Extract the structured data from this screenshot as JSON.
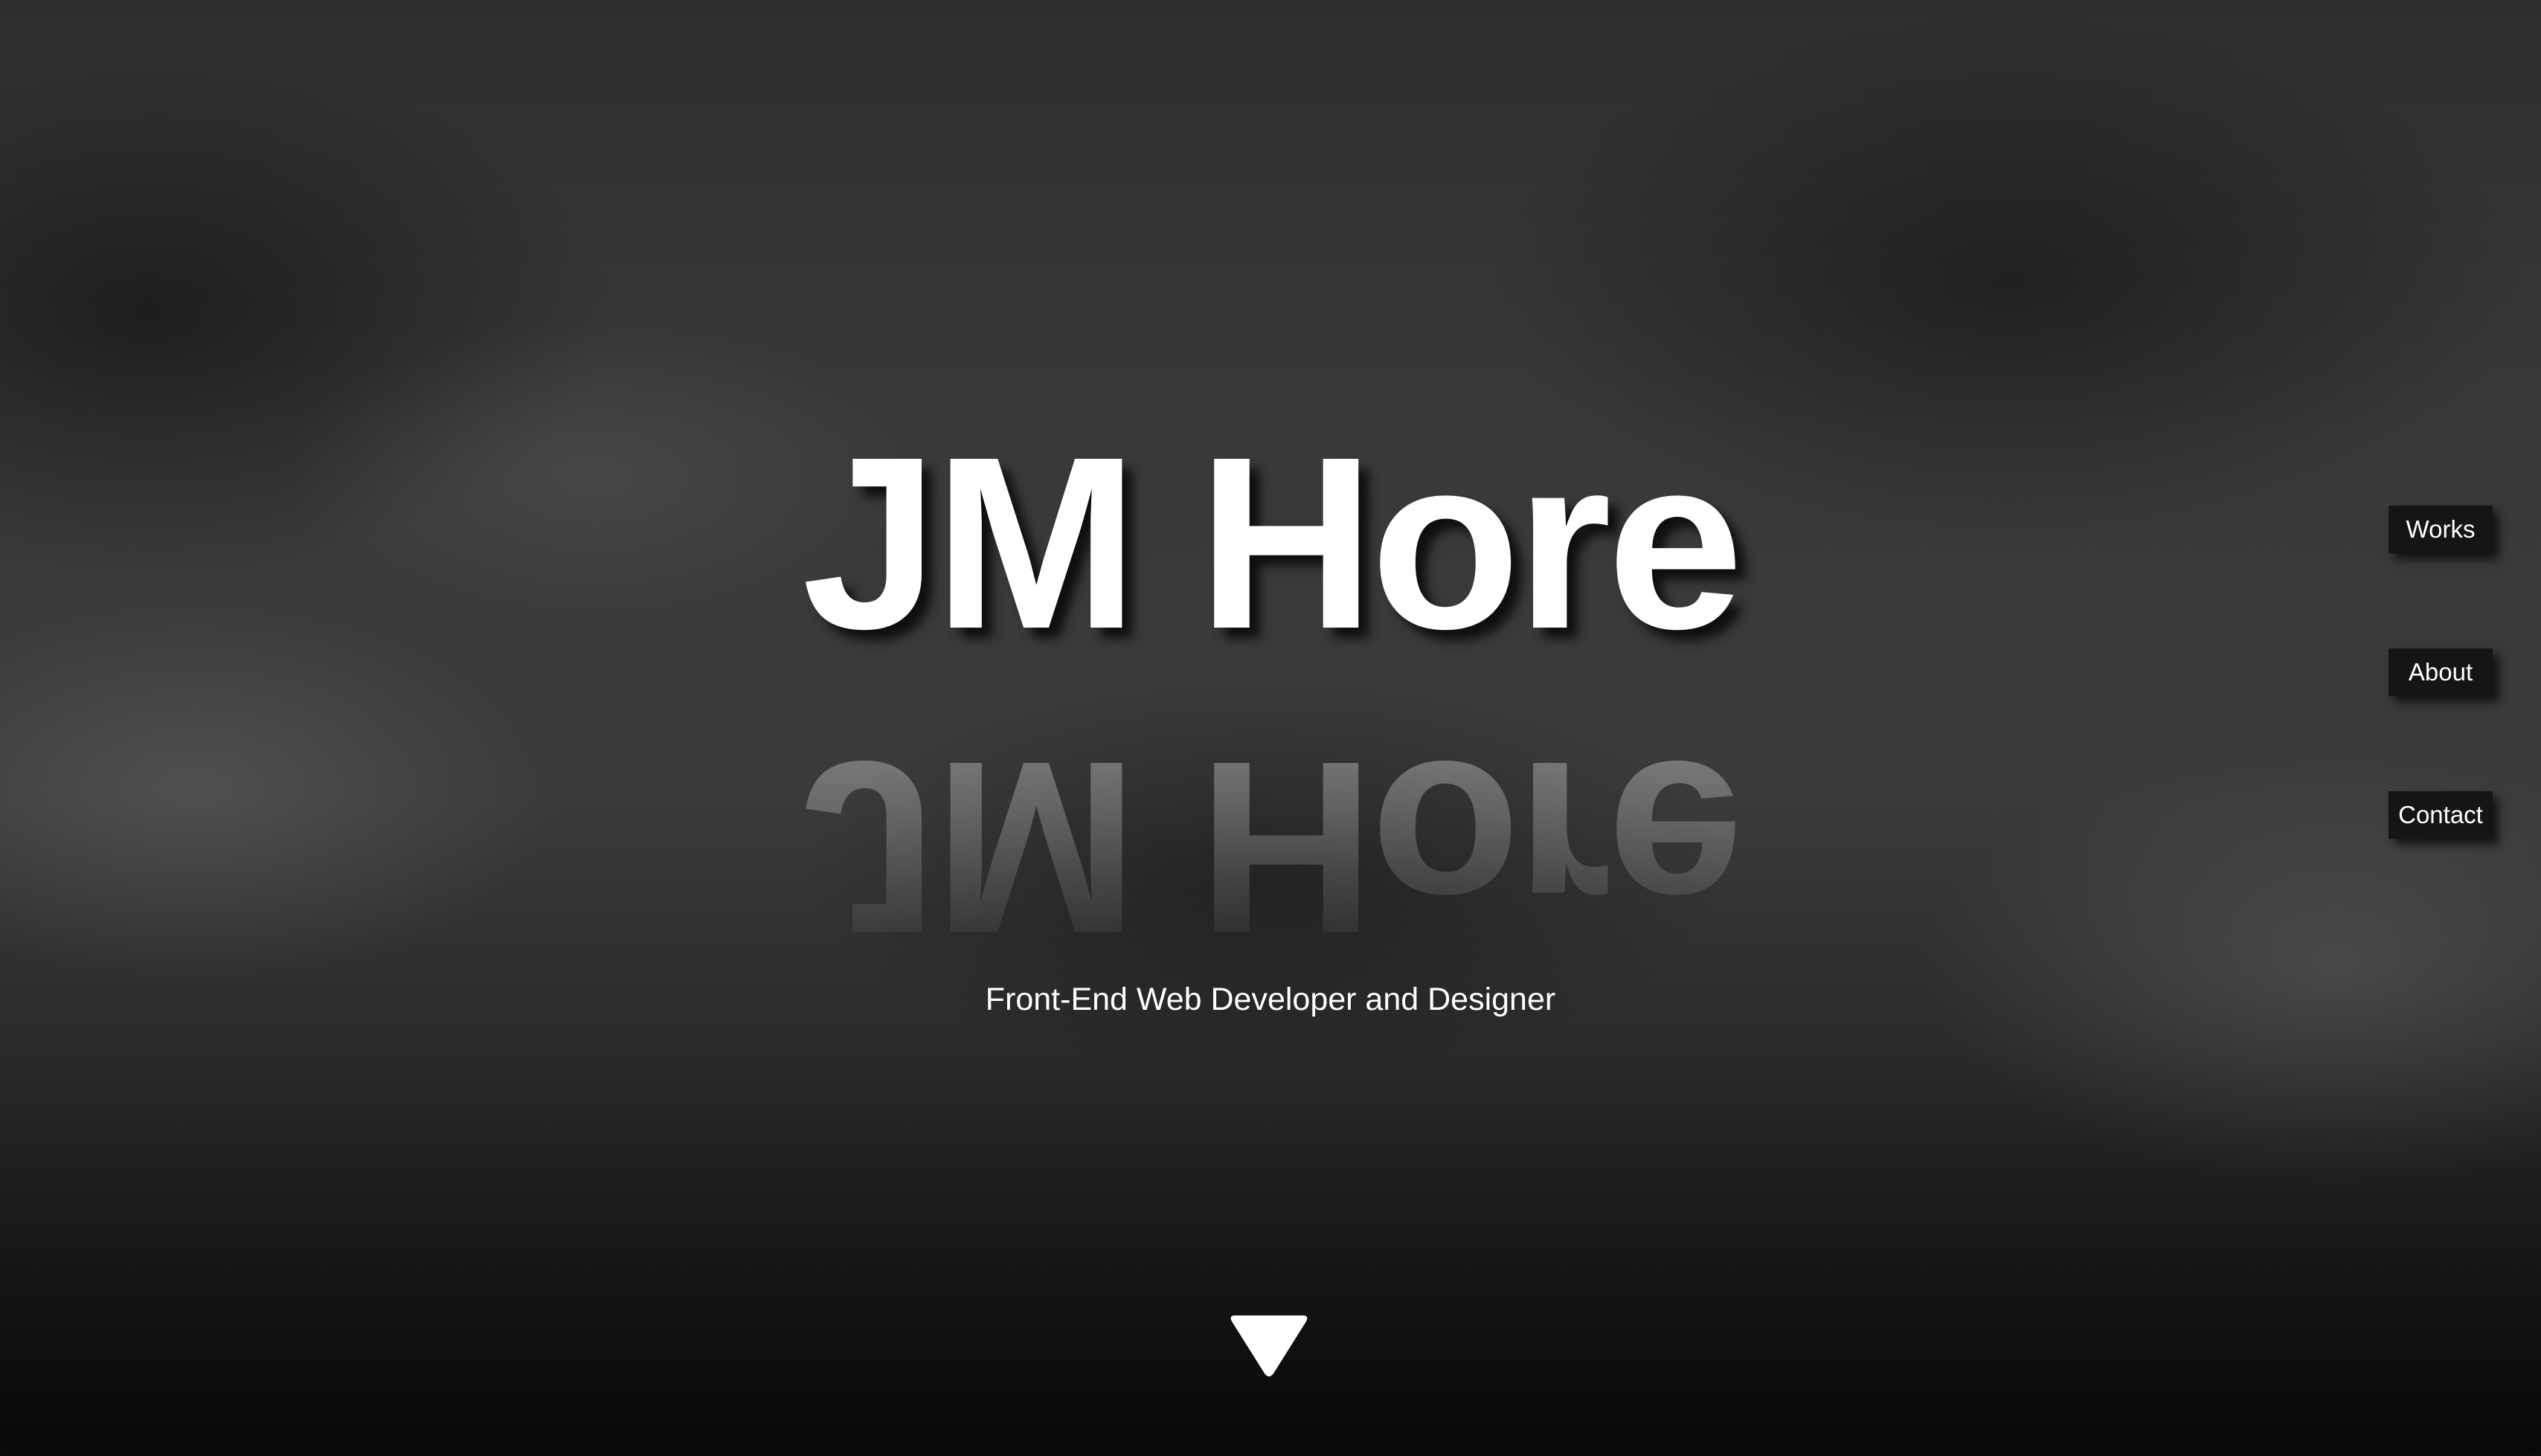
{
  "hero": {
    "title": "JM Hore",
    "subtitle": "Front-End Web Developer and Designer"
  },
  "nav": {
    "items": [
      {
        "label": "Works"
      },
      {
        "label": "About"
      },
      {
        "label": "Contact"
      }
    ]
  },
  "icons": {
    "scroll_down": "triangle-down-icon"
  }
}
